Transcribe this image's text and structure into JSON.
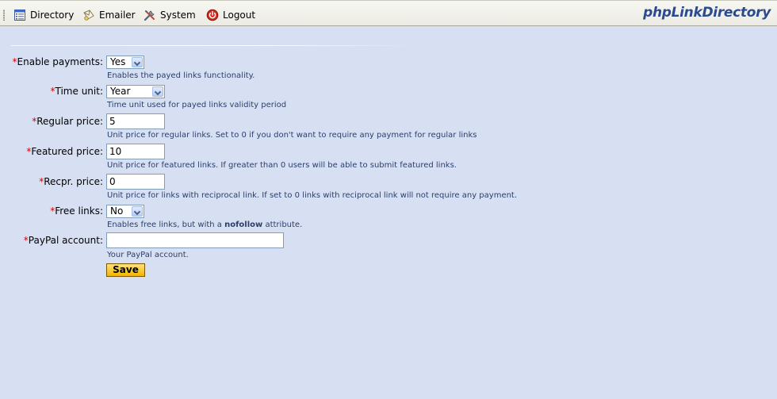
{
  "menu": {
    "items": [
      {
        "label": "Directory",
        "icon": "directory-icon"
      },
      {
        "label": "Emailer",
        "icon": "emailer-icon"
      },
      {
        "label": "System",
        "icon": "system-tools-icon"
      },
      {
        "label": "Logout",
        "icon": "logout-power-icon"
      }
    ],
    "brand": "phpLinkDirectory"
  },
  "form": {
    "required_mark": "*",
    "enable_payments": {
      "label": "Enable payments:",
      "value": "Yes",
      "help": "Enables the payed links functionality."
    },
    "time_unit": {
      "label": "Time unit:",
      "value": "Year",
      "help": "Time unit used for payed links validity period"
    },
    "regular_price": {
      "label": "Regular price:",
      "value": "5",
      "help": "Unit price for regular links. Set to 0 if you don't want to require any payment for regular links"
    },
    "featured_price": {
      "label": "Featured price:",
      "value": "10",
      "help": "Unit price for featured links. If greater than 0 users will be able to submit featured links."
    },
    "recpr_price": {
      "label": "Recpr. price:",
      "value": "0",
      "help": "Unit price for links with reciprocal link. If set to 0 links with reciprocal link will not require any payment."
    },
    "free_links": {
      "label": "Free links:",
      "value": "No",
      "help_before": "Enables free links, but with a ",
      "help_bold": "nofollow",
      "help_after": " attribute."
    },
    "paypal_account": {
      "label": "PayPal account:",
      "value": "",
      "help": "Your PayPal account."
    },
    "save_label": "Save"
  },
  "colors": {
    "background": "#d7e0f3",
    "required": "#d60000",
    "help_text": "#2a3f6a",
    "brand": "#2b4a8f",
    "save_button": "#f4b400"
  }
}
